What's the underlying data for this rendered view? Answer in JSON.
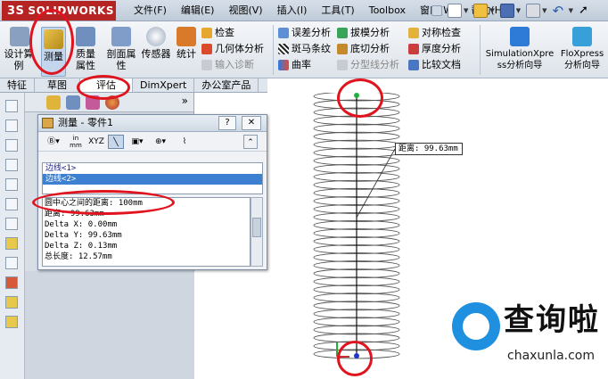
{
  "app": {
    "logo_text": "SOLIDWORKS",
    "logo_mark": "3S"
  },
  "menu": [
    "文件(F)",
    "编辑(E)",
    "视图(V)",
    "插入(I)",
    "工具(T)",
    "Toolbox",
    "窗口(W)",
    "帮助(H)"
  ],
  "ribbon": {
    "design_study": "设计算例",
    "measure": "测量",
    "mass_props": "质量属性",
    "section_props": "剖面属性",
    "sensor": "传感器",
    "statistics": "统计",
    "col1": [
      "检查",
      "几何体分析",
      "输入诊断"
    ],
    "col2": [
      "误差分析",
      "斑马条纹",
      "曲率"
    ],
    "col3": [
      "拔模分析",
      "底切分析",
      "分型线分析"
    ],
    "col4": [
      "对称检查",
      "厚度分析",
      "比较文档"
    ],
    "simxpress": "SimulationXpress分析向导",
    "floxpress": "FloXpress分析向导"
  },
  "tabs": [
    "特征",
    "草图",
    "评估",
    "DimXpert",
    "办公室产品"
  ],
  "dialog": {
    "title": "测量 - 零件1",
    "help": "?",
    "close": "✕",
    "tool_units": "in mm",
    "tool_xyz": "XYZ",
    "selections": [
      "边线<1>",
      "边线<2>"
    ],
    "results": [
      "圆中心之间的距离:  100mm",
      "距离: 99.63mm",
      "Delta X: 0.00mm",
      "Delta Y: 99.63mm",
      "Delta Z: 0.13mm",
      "总长度: 12.57mm"
    ]
  },
  "callout": "距离: 99.63mm",
  "watermark": {
    "title": "查询啦",
    "url": "chaxunla.com"
  },
  "colors": {
    "accent": "#3d7fd1",
    "annotation": "#e0141f",
    "logo": "#b52323"
  }
}
